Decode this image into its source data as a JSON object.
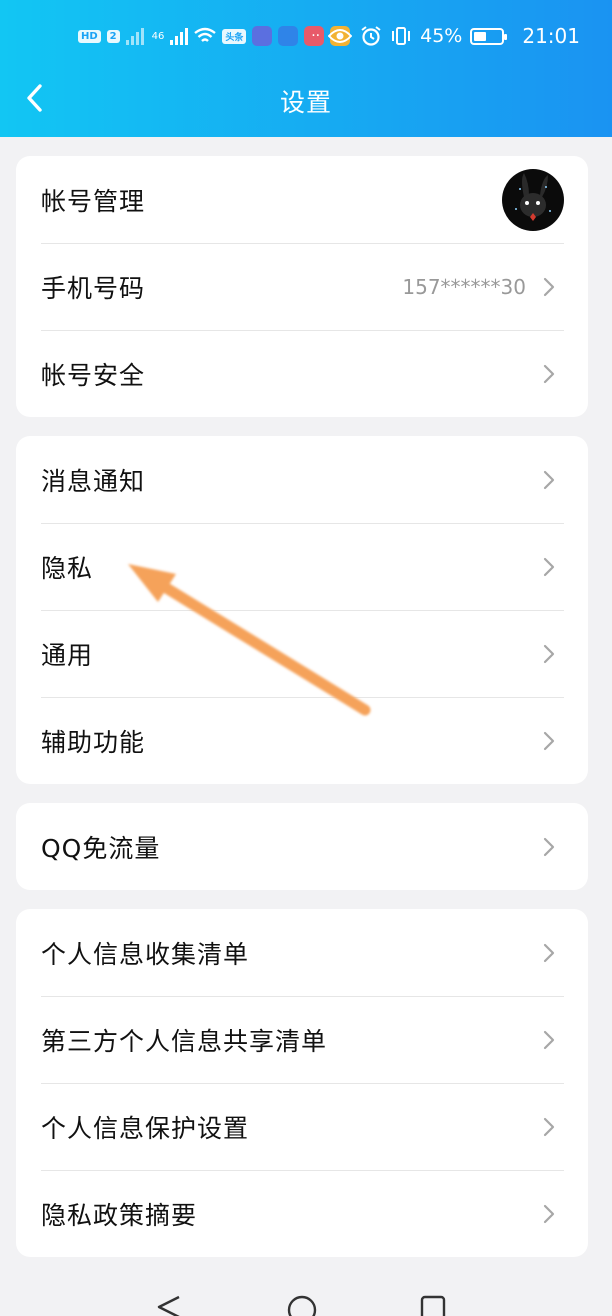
{
  "status_bar": {
    "network_badge": "HD",
    "sim_badge": "2",
    "signal_label": "46",
    "news_badge": "头条",
    "battery_percent": "45%",
    "battery_level": 0.45,
    "time": "21:01",
    "dots": "··"
  },
  "header": {
    "title": "设置",
    "back_icon": "chevron-left-icon",
    "background_colors": [
      "#12c6f3",
      "#1a93f2"
    ]
  },
  "groups": [
    {
      "rows": [
        {
          "label": "帐号管理",
          "type": "avatar"
        },
        {
          "label": "手机号码",
          "value": "157******30"
        },
        {
          "label": "帐号安全"
        }
      ]
    },
    {
      "rows": [
        {
          "label": "消息通知"
        },
        {
          "label": "隐私"
        },
        {
          "label": "通用"
        },
        {
          "label": "辅助功能"
        }
      ]
    },
    {
      "rows": [
        {
          "label": "QQ免流量"
        }
      ]
    },
    {
      "rows": [
        {
          "label": "个人信息收集清单"
        },
        {
          "label": "第三方个人信息共享清单"
        },
        {
          "label": "个人信息保护设置"
        },
        {
          "label": "隐私政策摘要"
        }
      ]
    }
  ],
  "annotation": {
    "arrow_color": "#f5a25a"
  },
  "nav": {
    "back_icon": "triangle-back-icon",
    "home_icon": "circle-home-icon",
    "recents_icon": "square-recents-icon"
  }
}
